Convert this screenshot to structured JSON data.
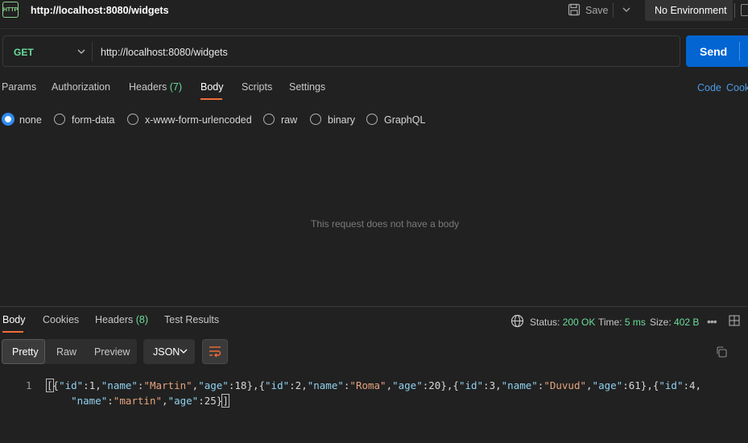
{
  "window": {
    "http_icon_text": "HTTP",
    "tab_title": "http://localhost:8080/widgets",
    "save_label": "Save",
    "environment_label": "No Environment"
  },
  "request": {
    "method": "GET",
    "url": "http://localhost:8080/widgets",
    "send_label": "Send",
    "tabs": {
      "params": "Params",
      "authorization": "Authorization",
      "headers": "Headers",
      "headers_count": "(7)",
      "body": "Body",
      "scripts": "Scripts",
      "settings": "Settings"
    },
    "code_link": "Code",
    "cookies_link": "Cookies",
    "body_types": {
      "none": "none",
      "form_data": "form-data",
      "urlencoded": "x-www-form-urlencoded",
      "raw": "raw",
      "binary": "binary",
      "graphql": "GraphQL"
    },
    "selected_body_type": "none",
    "empty_body_message": "This request does not have a body"
  },
  "response": {
    "tabs": {
      "body": "Body",
      "cookies": "Cookies",
      "headers": "Headers",
      "headers_count": "(8)",
      "test_results": "Test Results"
    },
    "status_label": "Status:",
    "status_value": "200 OK",
    "time_label": "Time:",
    "time_value": "5 ms",
    "size_label": "Size:",
    "size_value": "402 B",
    "formats": {
      "pretty": "Pretty",
      "raw": "Raw",
      "preview": "Preview"
    },
    "language": "JSON",
    "line_number": "1",
    "json_body": [
      {
        "id": 1,
        "name": "Martin",
        "age": 18
      },
      {
        "id": 2,
        "name": "Roma",
        "age": 20
      },
      {
        "id": 3,
        "name": "Duvud",
        "age": 61
      },
      {
        "id": 4,
        "name": "martin",
        "age": 25
      }
    ]
  },
  "colors": {
    "accent": "#f26b3a",
    "send": "#0265d2",
    "success": "#6bdd9a",
    "json_key": "#8fd1ee",
    "json_string": "#e5a47e"
  }
}
